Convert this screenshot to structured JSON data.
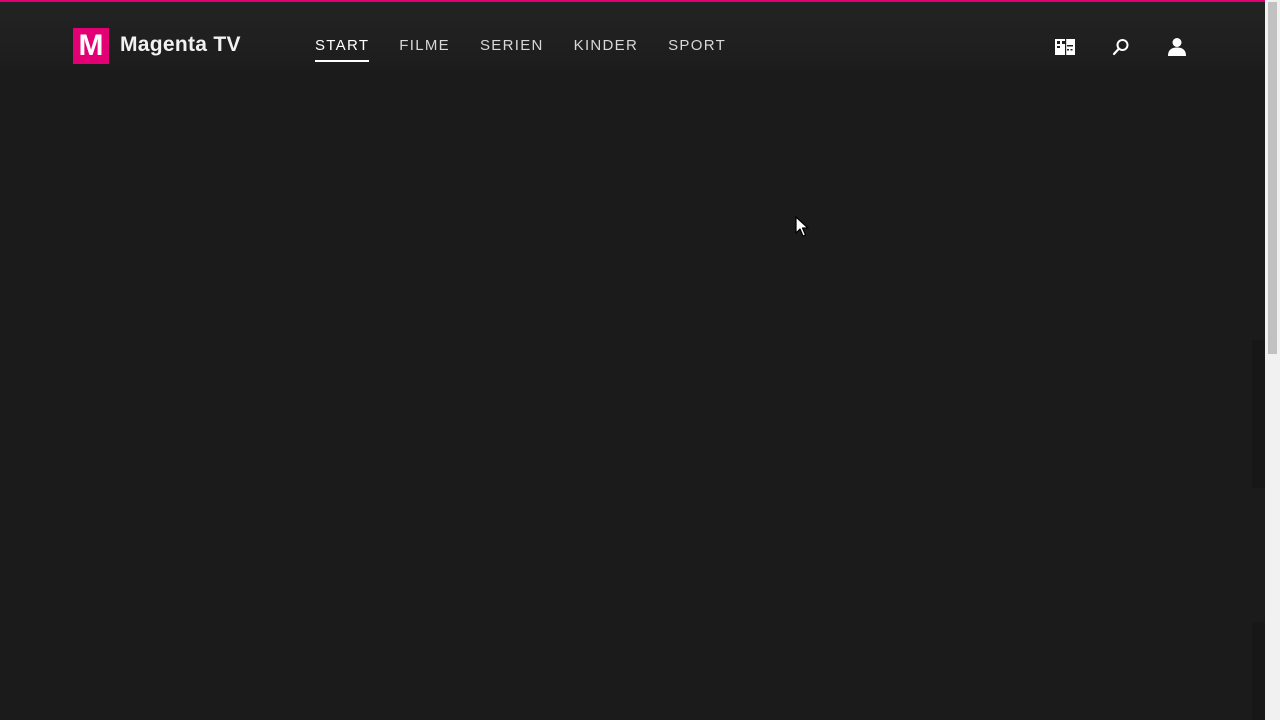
{
  "brand": {
    "logo_letter": "M",
    "name": "Magenta TV",
    "accent_color": "#e20074"
  },
  "nav": {
    "items": [
      {
        "label": "START",
        "active": true
      },
      {
        "label": "FILME",
        "active": false
      },
      {
        "label": "SERIEN",
        "active": false
      },
      {
        "label": "KINDER",
        "active": false
      },
      {
        "label": "SPORT",
        "active": false
      }
    ]
  },
  "header_icons": {
    "guide": "tv-guide-icon",
    "search": "search-icon",
    "profile": "user-icon"
  },
  "colors": {
    "background": "#1b1b1b",
    "text": "#ffffff"
  }
}
